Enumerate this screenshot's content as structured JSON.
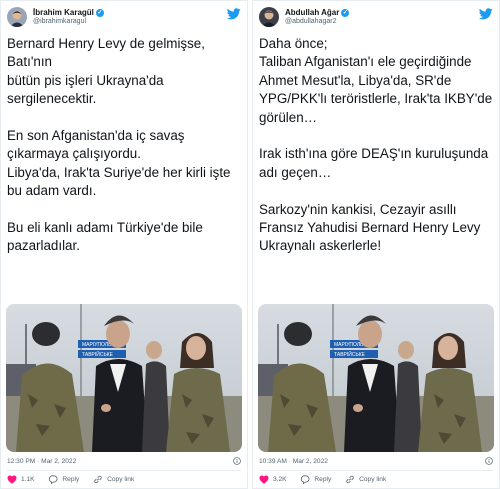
{
  "tweets": [
    {
      "author": {
        "name": "İbrahim Karagül",
        "handle": "@ibrahimkaragul"
      },
      "text_lines": [
        "Bernard Henry Levy de gelmişse,",
        "Batı'nın",
        "bütün pis işleri Ukrayna'da",
        "sergilenecektir.",
        "",
        "En son Afganistan'da iç savaş",
        "çıkarmaya çalışıyordu.",
        "Libya'da, Irak'ta Suriye'de her kirli işte",
        "bu adam vardı.",
        "",
        "Bu eli kanlı adamı Türkiye'de bile",
        "pazarladılar."
      ],
      "timestamp": "12:30 PM · Mar 2, 2022",
      "likes": "1.1K",
      "reply_label": "Reply",
      "copy_label": "Copy link",
      "sign_labels": [
        "МАРІУПОЛЬ",
        "ТАВРІЙСЬКЕ"
      ]
    },
    {
      "author": {
        "name": "Abdullah Ağar",
        "handle": "@abdullahagar2"
      },
      "text_lines": [
        "Daha önce;",
        "Taliban Afganistan'ı ele geçirdiğinde",
        "Ahmet Mesut'la, Libya'da, SR'de",
        "YPG/PKK'lı teröristlerle, Irak'ta IKBY'de",
        "görülen…",
        "",
        "Irak isth'ına göre DEAŞ'ın kuruluşunda",
        "adı geçen…",
        "",
        "Sarkozy'nin kankisi, Cezayir asıllı",
        "Fransız Yahudisi Bernard Henry Levy",
        "Ukraynalı askerlerle!"
      ],
      "timestamp": "10:39 AM · Mar 2, 2022",
      "likes": "3.2K",
      "reply_label": "Reply",
      "copy_label": "Copy link",
      "sign_labels": [
        "МАРІУПОЛЬ",
        "ТАВРІЙСЬКЕ"
      ]
    }
  ],
  "colors": {
    "accent": "#1d9bf0",
    "like": "#f91880",
    "muted": "#536471",
    "border": "#e6ecf0"
  },
  "icons": [
    "twitter-bird-icon",
    "verified-badge-icon",
    "info-icon",
    "heart-icon",
    "reply-icon",
    "link-icon"
  ]
}
